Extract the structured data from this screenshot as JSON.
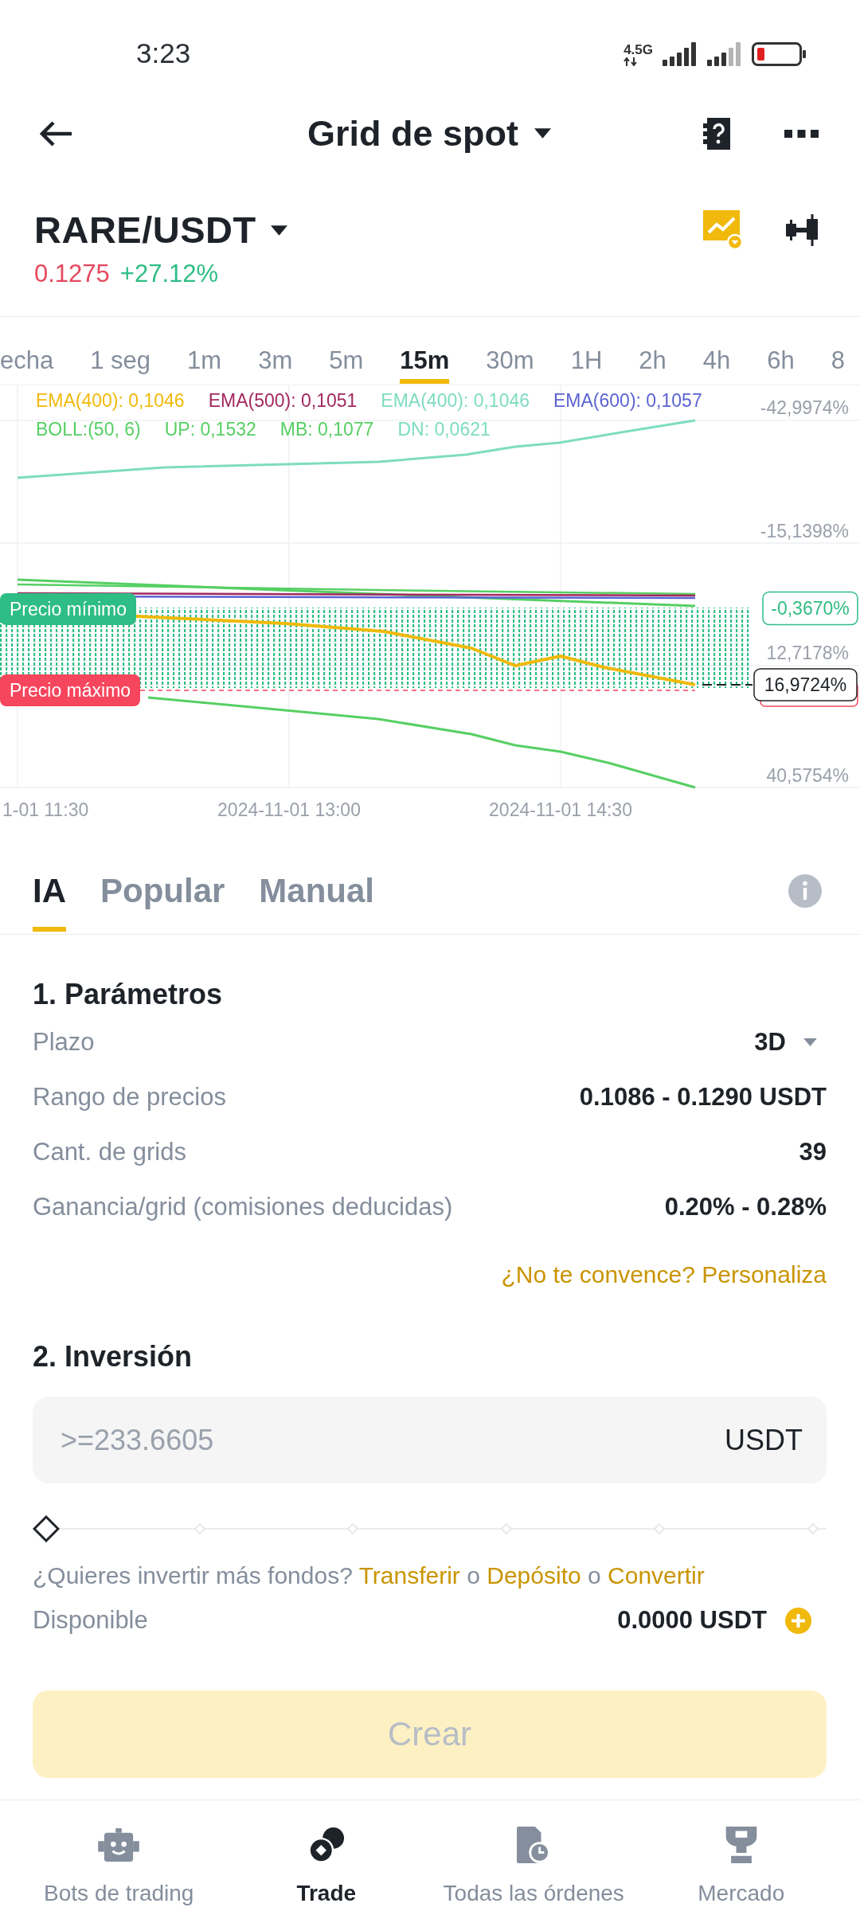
{
  "status_bar": {
    "time": "3:23",
    "network": "4.5G"
  },
  "header": {
    "title": "Grid de spot"
  },
  "pair": {
    "symbol": "RARE/USDT",
    "price": "0.1275",
    "change": "+27.12%"
  },
  "timeframes": [
    {
      "label": "echa",
      "selected": false
    },
    {
      "label": "1 seg",
      "selected": false
    },
    {
      "label": "1m",
      "selected": false
    },
    {
      "label": "3m",
      "selected": false
    },
    {
      "label": "5m",
      "selected": false
    },
    {
      "label": "15m",
      "selected": true
    },
    {
      "label": "30m",
      "selected": false
    },
    {
      "label": "1H",
      "selected": false
    },
    {
      "label": "2h",
      "selected": false
    },
    {
      "label": "4h",
      "selected": false
    },
    {
      "label": "6h",
      "selected": false
    },
    {
      "label": "8",
      "selected": false
    }
  ],
  "chart": {
    "legend": [
      {
        "items": [
          {
            "text": "EMA(400): 0,1046",
            "color": "#f0b90b"
          },
          {
            "text": "EMA(500): 0,1051",
            "color": "#a3285e"
          },
          {
            "text": "EMA(400): 0,1046",
            "color": "#7edcc1"
          },
          {
            "text": "EMA(600): 0,1057",
            "color": "#5b63d3"
          }
        ]
      },
      {
        "items": [
          {
            "text": "BOLL:(50, 6)",
            "color": "#56cf63"
          },
          {
            "text": "UP: 0,1532",
            "color": "#56cf63"
          },
          {
            "text": "MB: 0,1077",
            "color": "#56cf63"
          },
          {
            "text": "DN: 0,0621",
            "color": "#7edcc1"
          }
        ]
      }
    ],
    "y_labels": [
      {
        "text": "-42,9974%",
        "kind": "axis"
      },
      {
        "text": "-15,1398%",
        "kind": "axis"
      },
      {
        "text": "-0,3670%",
        "kind": "range"
      },
      {
        "text": "12,7178%",
        "kind": "axis"
      },
      {
        "text": "16,9724%",
        "kind": "last"
      },
      {
        "text": "40,5754%",
        "kind": "axis"
      }
    ],
    "x_labels": [
      "1-01 11:30",
      "2024-11-01 13:00",
      "2024-11-01 14:30"
    ],
    "markers": [
      {
        "label": "Precio mínimo",
        "kind": "min"
      },
      {
        "label": "Precio máximo",
        "kind": "max"
      }
    ]
  },
  "strategy_tabs": [
    {
      "label": "IA",
      "selected": true
    },
    {
      "label": "Popular",
      "selected": false
    },
    {
      "label": "Manual",
      "selected": false
    }
  ],
  "parameters": {
    "title": "1. Parámetros",
    "rows": [
      {
        "label": "Plazo",
        "value": "3D",
        "kind": "dropdown"
      },
      {
        "label": "Rango de precios",
        "value": "0.1086 - 0.1290 USDT",
        "kind": "text"
      },
      {
        "label": "Cant. de grids",
        "value": "39",
        "kind": "text"
      },
      {
        "label": "Ganancia/grid (comisiones deducidas)",
        "value": "0.20% - 0.28%",
        "kind": "text"
      }
    ],
    "link": "¿No te convence? Personaliza"
  },
  "investment": {
    "title": "2. Inversión",
    "placeholder": ">=233.6605",
    "unit": "USDT",
    "slider": {
      "level": 0
    },
    "prompt": [
      {
        "text": "¿Quieres invertir más fondos?",
        "kind": "text"
      },
      {
        "text": "Transferir",
        "kind": "link"
      },
      {
        "text": "o",
        "kind": "text"
      },
      {
        "text": "Depósito",
        "kind": "link"
      },
      {
        "text": "o",
        "kind": "text"
      },
      {
        "text": "Convertir",
        "kind": "link"
      }
    ],
    "available": {
      "label": "Disponible",
      "value": "0.0000 USDT"
    }
  },
  "create_button": {
    "label": "Crear",
    "disabled": true
  },
  "bottom_nav": [
    {
      "label": "Bots de trading",
      "kind": "robot",
      "selected": false
    },
    {
      "label": "Trade",
      "kind": "coins",
      "selected": true
    },
    {
      "label": "Todas las órdenes",
      "kind": "orders",
      "selected": false
    },
    {
      "label": "Mercado",
      "kind": "trophy",
      "selected": false
    }
  ]
}
